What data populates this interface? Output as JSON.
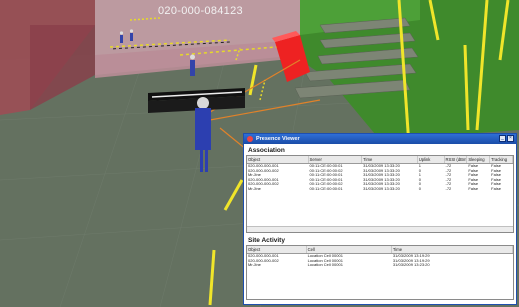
{
  "scene": {
    "floor_label": "020-000-084123"
  },
  "window": {
    "title": "Presence Viewer",
    "min_label": "_",
    "close_label": "×"
  },
  "association": {
    "title": "Association",
    "columns": [
      "Object",
      "Server",
      "Time",
      "Uplink",
      "RSSI (dBm)",
      "Sleeping",
      "Tracking"
    ],
    "rows": [
      [
        "020-000-000-001",
        "00:11:CE:00:00:01",
        "31/03/2009 13:33:20",
        "1",
        "-72",
        "False",
        "False"
      ],
      [
        "020-000-000-002",
        "00:11:CE:00:00:02",
        "31/03/2009 13:33:20",
        "0",
        "-72",
        "False",
        "False"
      ],
      [
        "Mr.Jine",
        "00:11:CE:00:00:01",
        "31/03/2009 13:33:20",
        "1",
        "-72",
        "False",
        "False"
      ],
      [
        "020-000-000-001",
        "00:11:CE:00:00:01",
        "31/03/2009 13:33:20",
        "0",
        "-72",
        "False",
        "False"
      ],
      [
        "020-000-000-002",
        "00:11:CE:00:00:02",
        "31/03/2009 13:33:20",
        "0",
        "-72",
        "False",
        "False"
      ],
      [
        "Mr.Jine",
        "00:11:CE:00:00:01",
        "31/03/2009 13:33:20",
        "0",
        "-72",
        "False",
        "False"
      ]
    ]
  },
  "site_activity": {
    "title": "Site Activity",
    "columns": [
      "Object",
      "Cell",
      "Time"
    ],
    "rows": [
      [
        "020-000-000-001",
        "Location Cell 00001",
        "31/03/2009 13:19:29"
      ],
      [
        "020-000-000-002",
        "Location Cell 00001",
        "31/03/2009 13:19:29"
      ],
      [
        "Mr.Jine",
        "Location Cell 00001",
        "31/03/2009 13:23:20"
      ]
    ]
  },
  "colors": {
    "floor": "#5f6a5a",
    "pink_overlay": "#c99aa6",
    "red_cube": "#ee2222",
    "yellow_rail": "#f0e52a",
    "green_block": "#3f8a2c",
    "title_bar": "#1f5bc4"
  }
}
